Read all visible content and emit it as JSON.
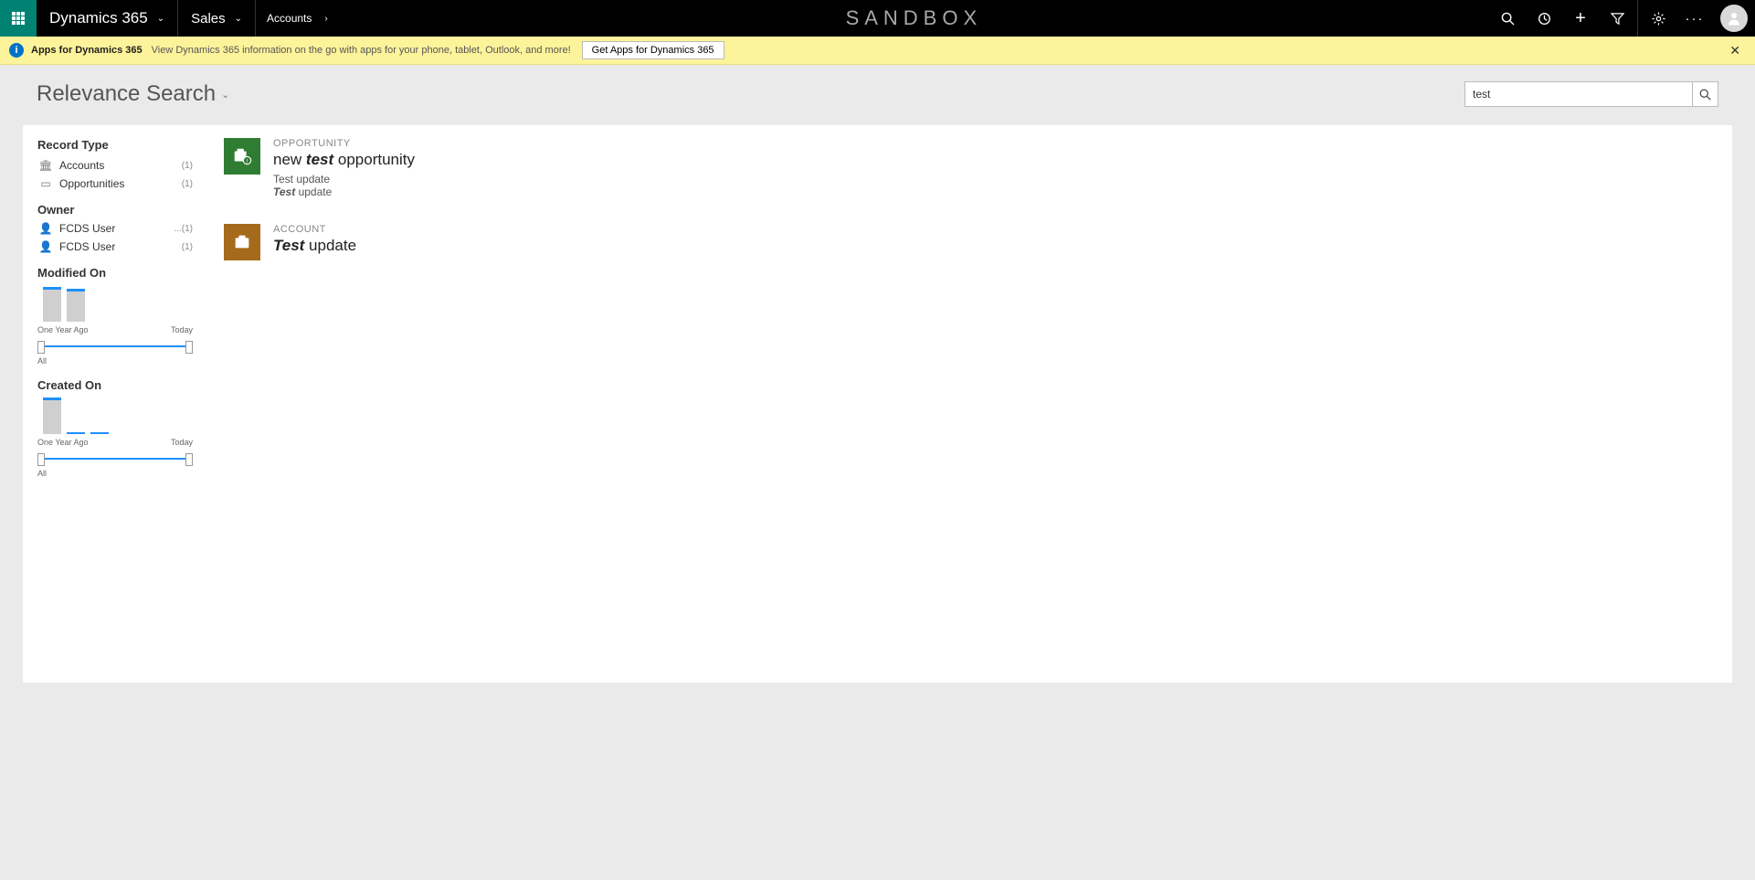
{
  "topnav": {
    "brand": "Dynamics 365",
    "module": "Sales",
    "breadcrumb": "Accounts",
    "env": "SANDBOX"
  },
  "banner": {
    "title": "Apps for Dynamics 365",
    "desc": "View Dynamics 365 information on the go with apps for your phone, tablet, Outlook, and more!",
    "button": "Get Apps for Dynamics 365"
  },
  "page": {
    "title": "Relevance Search",
    "search_value": "test"
  },
  "facets": {
    "record_type_header": "Record Type",
    "types": [
      {
        "label": "Accounts",
        "count": "(1)"
      },
      {
        "label": "Opportunities",
        "count": "(1)"
      }
    ],
    "owner_header": "Owner",
    "owners": [
      {
        "label": "FCDS User",
        "count": "...(1)"
      },
      {
        "label": "FCDS User",
        "count": "(1)"
      }
    ],
    "modified_header": "Modified On",
    "created_header": "Created On",
    "axis_from": "One Year Ago",
    "axis_to": "Today",
    "all_label": "All"
  },
  "results": [
    {
      "entity": "OPPORTUNITY",
      "title_pre": "new ",
      "title_hl": "test",
      "title_post": " opportunity",
      "line1": "Test update",
      "line2_hl": "Test",
      "line2_post": " update"
    },
    {
      "entity": "ACCOUNT",
      "title_hl": "Test",
      "title_post": " update"
    }
  ],
  "chart_data": [
    {
      "type": "bar",
      "title": "Modified On",
      "x_range": [
        "One Year Ago",
        "Today"
      ],
      "bars": [
        38,
        36
      ],
      "note": "two grey bars with blue caps; remaining buckets empty; values are relative pixel heights (no numeric axis shown)"
    },
    {
      "type": "bar",
      "title": "Created On",
      "x_range": [
        "One Year Ago",
        "Today"
      ],
      "bars": [
        40
      ],
      "ticks_after": 2,
      "note": "one grey bar with blue cap plus two short blue tick marks; values relative"
    }
  ]
}
